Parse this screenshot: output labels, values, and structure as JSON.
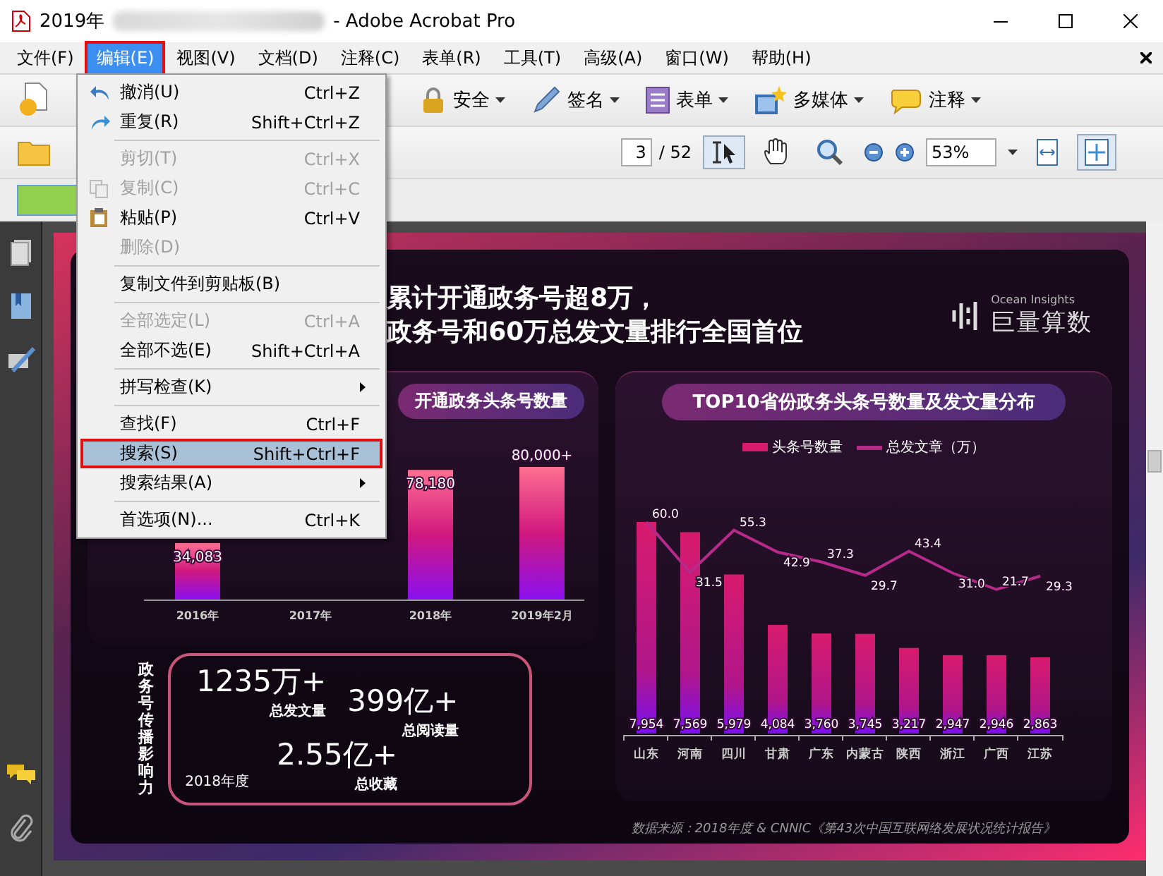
{
  "window": {
    "title_start": "2019年",
    "title_end": "- Adobe Acrobat Pro"
  },
  "menu_bar": {
    "items": [
      {
        "label": "文件(F)",
        "selected": false,
        "annotated": false
      },
      {
        "label": "编辑(E)",
        "selected": true,
        "annotated": true
      },
      {
        "label": "视图(V)",
        "selected": false,
        "annotated": false
      },
      {
        "label": "文档(D)",
        "selected": false,
        "annotated": false
      },
      {
        "label": "注释(C)",
        "selected": false,
        "annotated": false
      },
      {
        "label": "表单(R)",
        "selected": false,
        "annotated": false
      },
      {
        "label": "工具(T)",
        "selected": false,
        "annotated": false
      },
      {
        "label": "高级(A)",
        "selected": false,
        "annotated": false
      },
      {
        "label": "窗口(W)",
        "selected": false,
        "annotated": false
      },
      {
        "label": "帮助(H)",
        "selected": false,
        "annotated": false
      }
    ]
  },
  "edit_menu": {
    "items": [
      {
        "kind": "item",
        "label": "撤消(U)",
        "shortcut": "Ctrl+Z",
        "disabled": false,
        "selected": false,
        "annotated": false,
        "submenu": false
      },
      {
        "kind": "item",
        "label": "重复(R)",
        "shortcut": "Shift+Ctrl+Z",
        "disabled": false,
        "selected": false,
        "annotated": false,
        "submenu": false
      },
      {
        "kind": "separator"
      },
      {
        "kind": "item",
        "label": "剪切(T)",
        "shortcut": "Ctrl+X",
        "disabled": true,
        "selected": false,
        "annotated": false,
        "submenu": false
      },
      {
        "kind": "item",
        "label": "复制(C)",
        "shortcut": "Ctrl+C",
        "disabled": true,
        "selected": false,
        "annotated": false,
        "submenu": false
      },
      {
        "kind": "item",
        "label": "粘贴(P)",
        "shortcut": "Ctrl+V",
        "disabled": false,
        "selected": false,
        "annotated": false,
        "submenu": false
      },
      {
        "kind": "item",
        "label": "删除(D)",
        "disabled": true,
        "selected": false,
        "annotated": false,
        "submenu": false
      },
      {
        "kind": "separator"
      },
      {
        "kind": "item",
        "label": "复制文件到剪贴板(B)",
        "disabled": false,
        "selected": false,
        "annotated": false,
        "submenu": false
      },
      {
        "kind": "separator"
      },
      {
        "kind": "item",
        "label": "全部选定(L)",
        "shortcut": "Ctrl+A",
        "disabled": true,
        "selected": false,
        "annotated": false,
        "submenu": false
      },
      {
        "kind": "item",
        "label": "全部不选(E)",
        "shortcut": "Shift+Ctrl+A",
        "disabled": false,
        "selected": false,
        "annotated": false,
        "submenu": false
      },
      {
        "kind": "separator"
      },
      {
        "kind": "item",
        "label": "拼写检查(K)",
        "disabled": false,
        "selected": false,
        "annotated": false,
        "submenu": true
      },
      {
        "kind": "separator"
      },
      {
        "kind": "item",
        "label": "查找(F)",
        "shortcut": "Ctrl+F",
        "disabled": false,
        "selected": false,
        "annotated": false,
        "submenu": false
      },
      {
        "kind": "item",
        "label": "搜索(S)",
        "shortcut": "Shift+Ctrl+F",
        "disabled": false,
        "selected": true,
        "annotated": true,
        "submenu": false
      },
      {
        "kind": "item",
        "label": "搜索结果(A)",
        "disabled": false,
        "selected": false,
        "annotated": false,
        "submenu": true
      },
      {
        "kind": "separator"
      },
      {
        "kind": "item",
        "label": "首选项(N)...",
        "shortcut": "Ctrl+K",
        "disabled": false,
        "selected": false,
        "annotated": false,
        "submenu": false
      }
    ]
  },
  "toolbar": {
    "buttons": [
      {
        "label": "安全"
      },
      {
        "label": "签名"
      },
      {
        "label": "表单"
      },
      {
        "label": "多媒体"
      },
      {
        "label": "注释"
      }
    ]
  },
  "navigation": {
    "page": "3",
    "page_total": "/ 52",
    "zoom": "53%",
    "tools": [
      {
        "selected": true
      },
      {
        "selected": false
      },
      {
        "selected": false
      }
    ],
    "view_buttons": [
      {
        "selected": false
      },
      {
        "selected": true
      }
    ]
  },
  "document": {
    "headline": [
      "累计开通政务号超8万，",
      "政务号和60万总发文量排行全国首位"
    ],
    "logo": {
      "tagline": "Ocean Insights",
      "name": "巨量算数"
    },
    "left_card": {
      "title": "开通政务头条号数量",
      "chart_data": {
        "type": "bar",
        "categories": [
          "2016年",
          "2017年",
          "2018年",
          "2019年2月"
        ],
        "values": [
          34083,
          null,
          78180,
          80000
        ],
        "value_labels": [
          "34,083",
          null,
          "78,180",
          "80,000+"
        ]
      }
    },
    "impact": {
      "label": "政务号传播影响力",
      "year": "2018年度",
      "stats": [
        {
          "value": "1235万+",
          "caption": "总发文量"
        },
        {
          "value": "399亿+",
          "caption": "总阅读量"
        },
        {
          "value": "2.55亿+",
          "caption": "总收藏"
        }
      ]
    },
    "right_card": {
      "title": "TOP10省份政务头条号数量及发文量分布",
      "chart_data": {
        "type": "bar",
        "categories": [
          "山东",
          "河南",
          "四川",
          "甘肃",
          "广东",
          "内蒙古",
          "陕西",
          "浙江",
          "广西",
          "江苏"
        ],
        "series": [
          {
            "name": "头条号数量",
            "color": "#d81b6e",
            "values": [
              7954,
              7569,
              5979,
              4084,
              3760,
              3745,
              3217,
              2947,
              2946,
              2863
            ],
            "value_labels": [
              "7,954",
              "7,569",
              "5,979",
              "4,084",
              "3,760",
              "3,745",
              "3,217",
              "2,947",
              "2,946",
              "2,863"
            ]
          }
        ]
      },
      "line_overlay": {
        "chart_data": {
          "type": "line",
          "series": [
            {
              "name": "总发文章（万）",
              "color": "#b62a8a",
              "values": [
                60.0,
                31.5,
                55.3,
                42.9,
                37.3,
                29.7,
                43.4,
                31.0,
                21.7,
                29.3
              ],
              "value_labels": [
                "60.0",
                "31.5",
                "55.3",
                "42.9",
                "37.3",
                "29.7",
                "43.4",
                "31.0",
                "21.7",
                "29.3"
              ]
            }
          ]
        }
      }
    },
    "source": "数据来源：2018年度 & CNNIC《第43次中国互联网络发展状况统计报告》"
  }
}
